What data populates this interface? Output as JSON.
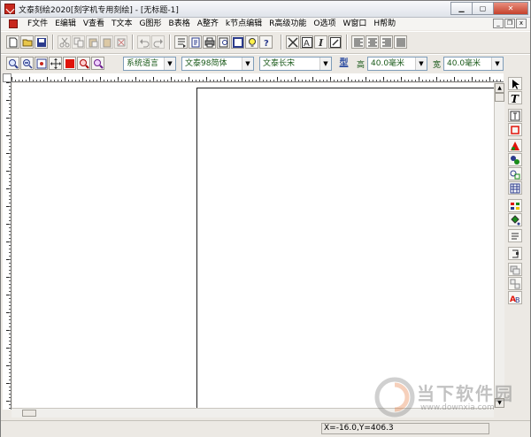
{
  "window": {
    "title": "文泰刻绘2020[刻字机专用刻绘] - [无标题-1]"
  },
  "menu": {
    "items": [
      {
        "label": "F文件"
      },
      {
        "label": "E编辑"
      },
      {
        "label": "V查看"
      },
      {
        "label": "T文本"
      },
      {
        "label": "G图形"
      },
      {
        "label": "B表格"
      },
      {
        "label": "A整齐"
      },
      {
        "label": "k节点编辑"
      },
      {
        "label": "R高级功能"
      },
      {
        "label": "O选项"
      },
      {
        "label": "W窗口"
      },
      {
        "label": "H帮助"
      }
    ]
  },
  "format_bar": {
    "language": "系统语言",
    "font": "文泰98简体",
    "width_font": "文泰长宋",
    "style_button": "型",
    "height_label": "高",
    "height_value": "40.0毫米",
    "width_label": "宽",
    "width_value": "40.0毫米"
  },
  "status": {
    "coords": "X=-16.0,Y=406.3"
  },
  "watermark": {
    "text": "当下软件园",
    "url": "www.downxia.com"
  },
  "colors": {
    "accent_red": "#c8281e",
    "label_green": "#1a5a1a"
  }
}
